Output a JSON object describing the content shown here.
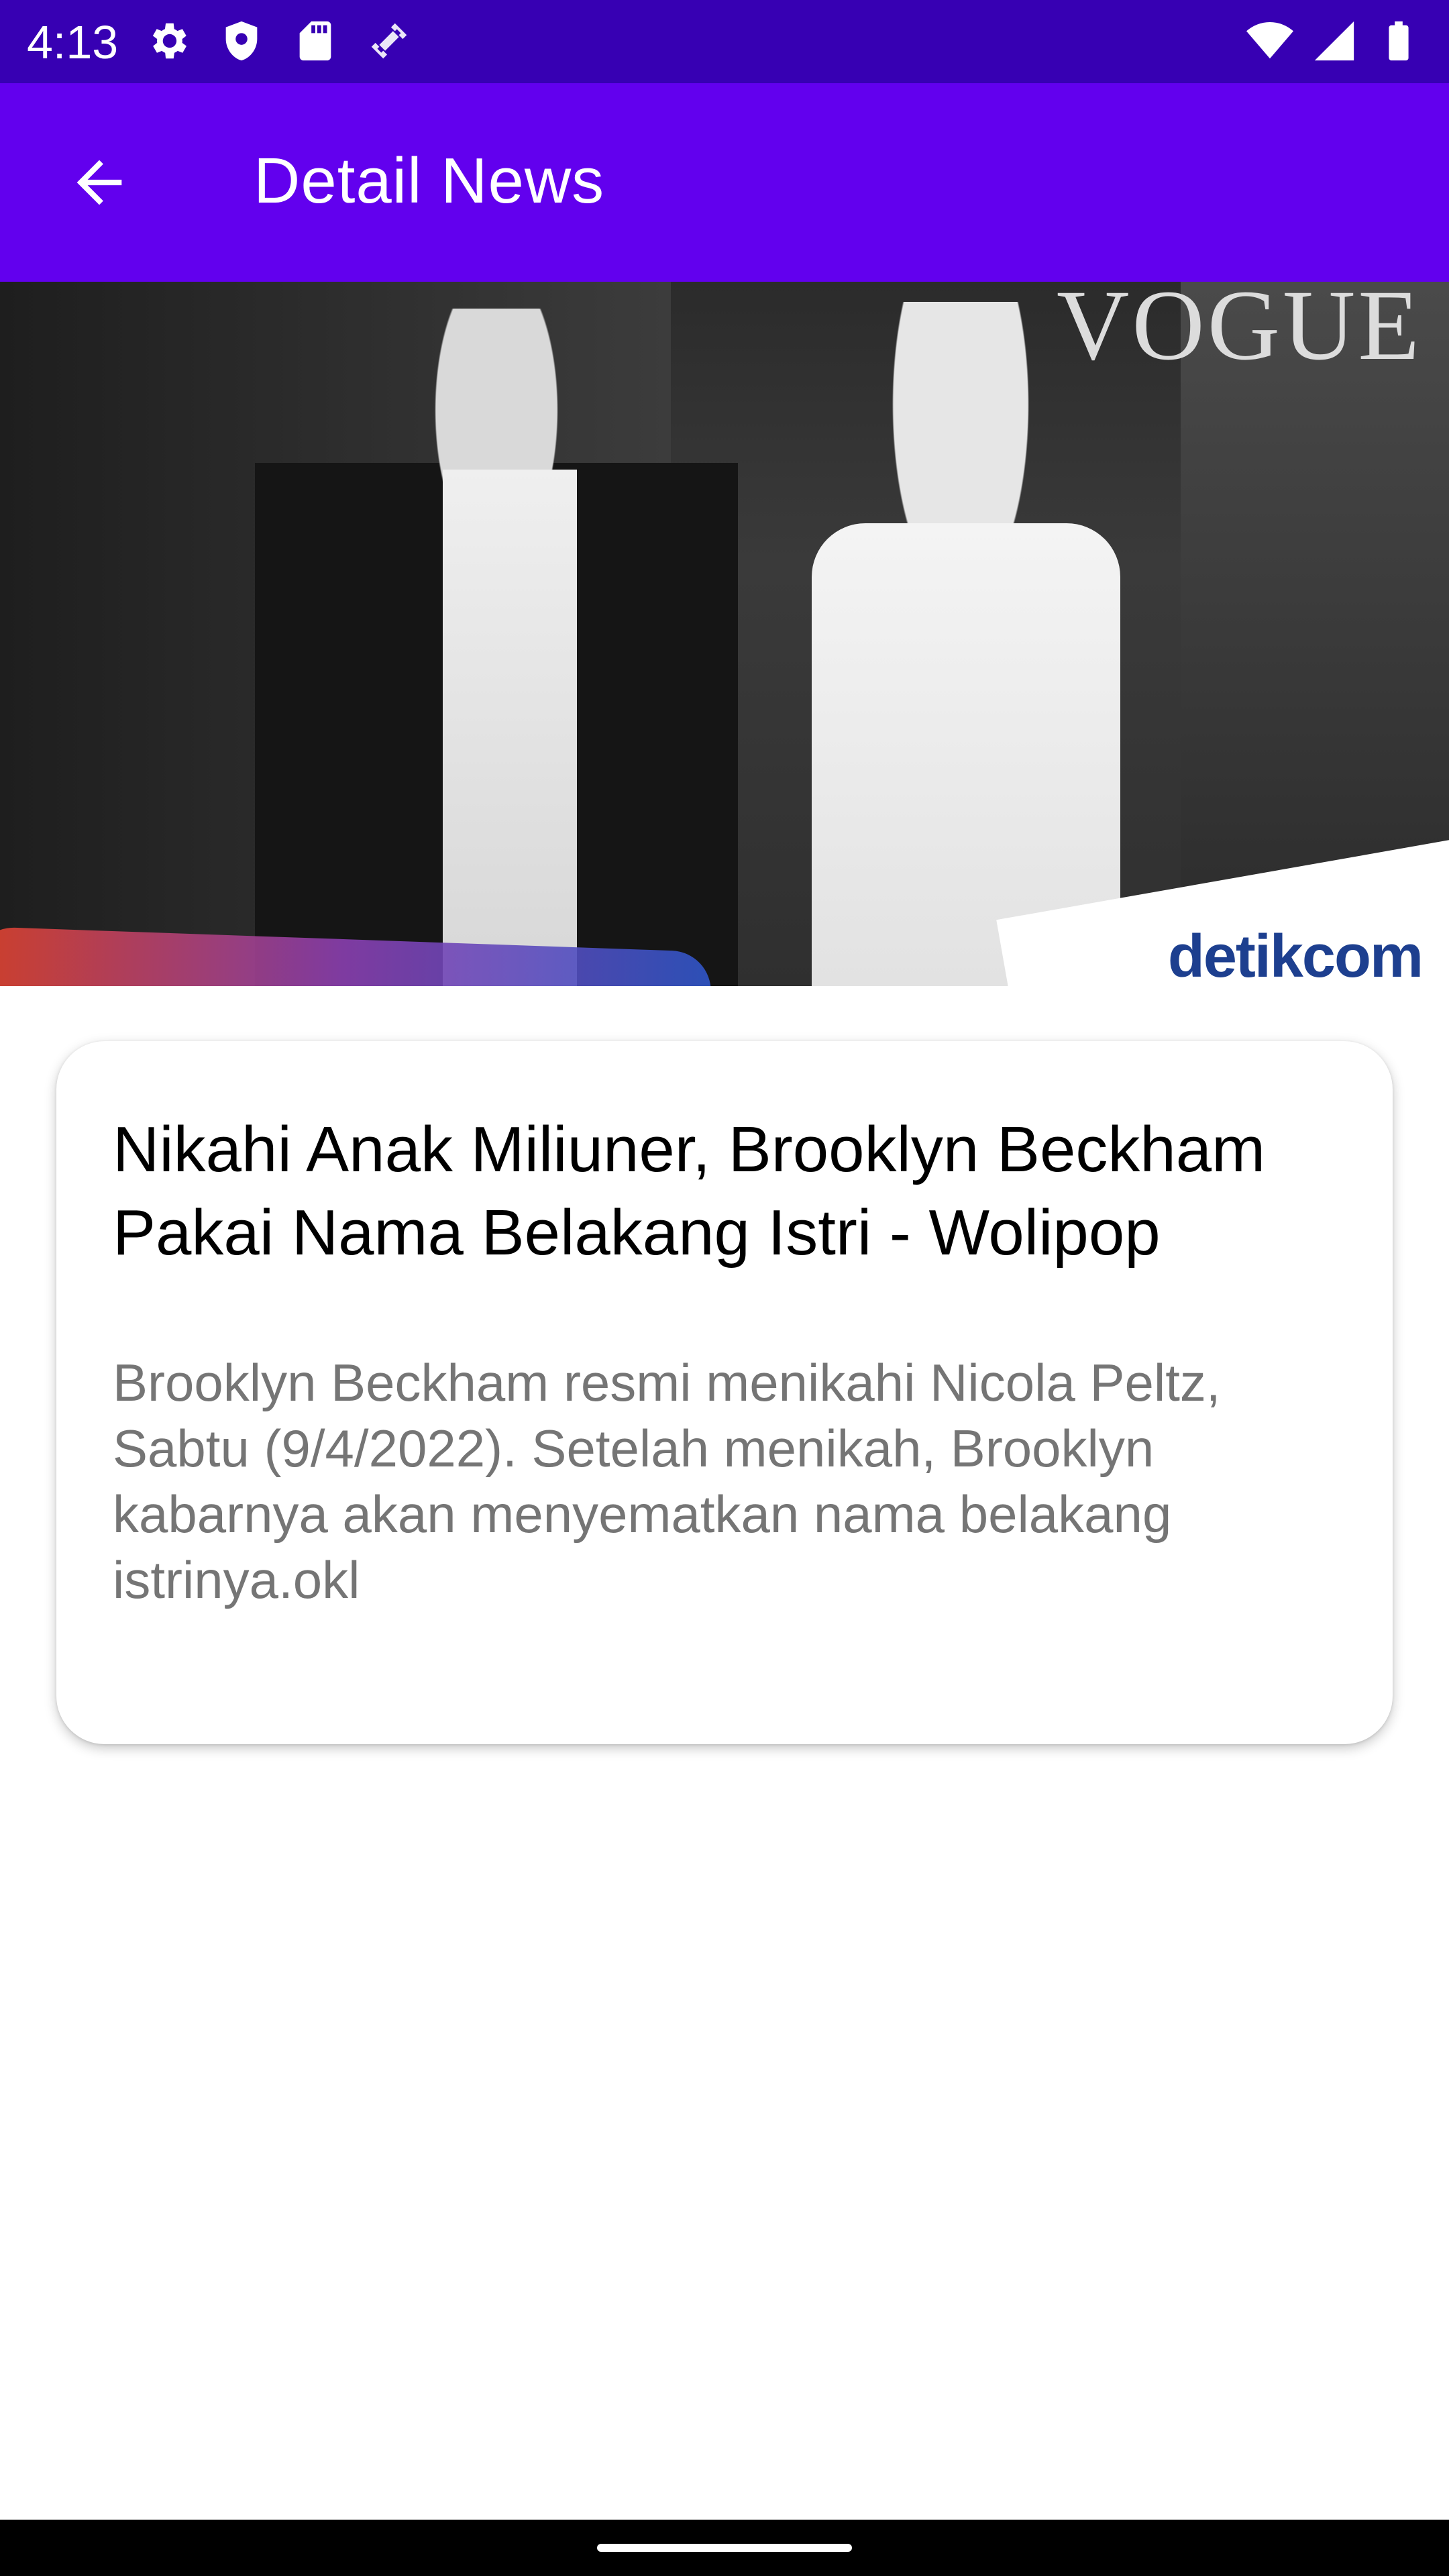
{
  "status_bar": {
    "time": "4:13",
    "left_icons": [
      "gear-icon",
      "shield-icon",
      "sd-card-icon",
      "rotate-icon"
    ],
    "right_icons": [
      "wifi-icon",
      "signal-icon",
      "battery-icon"
    ],
    "background": "#3700b3"
  },
  "app_bar": {
    "title": "Detail News",
    "back_icon": "arrow-back-icon",
    "background": "#6200ee"
  },
  "hero": {
    "watermark": "VOGUE",
    "logo": "detikcom"
  },
  "article": {
    "title": "Nikahi Anak Miliuner, Brooklyn Beckham Pakai Nama Belakang Istri - Wolipop",
    "description": "Brooklyn Beckham resmi menikahi Nicola Peltz, Sabtu (9/4/2022). Setelah menikah, Brooklyn kabarnya akan menyematkan nama belakang istrinya.okl"
  }
}
